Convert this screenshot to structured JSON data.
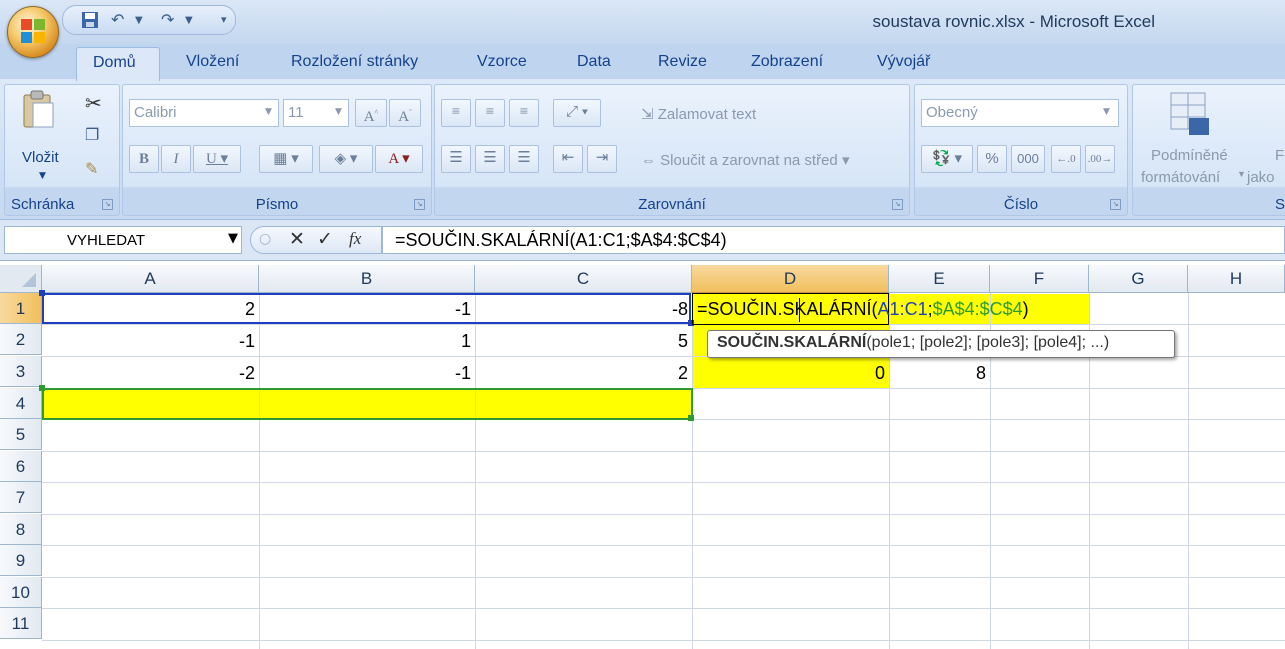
{
  "window": {
    "title": "soustava rovnic.xlsx - Microsoft Excel"
  },
  "tabs": [
    "Domů",
    "Vložení",
    "Rozložení stránky",
    "Vzorce",
    "Data",
    "Revize",
    "Zobrazení",
    "Vývojář"
  ],
  "ribbon": {
    "clipboard": {
      "label": "Schránka",
      "paste": "Vložit"
    },
    "font": {
      "label": "Písmo",
      "name": "Calibri",
      "size": "11"
    },
    "alignment": {
      "label": "Zarovnání",
      "wrap": "Zalamovat text",
      "merge": "Sloučit a zarovnat na střed"
    },
    "number": {
      "label": "Číslo",
      "format": "Obecný",
      "percent": "%",
      "thousands": "000"
    },
    "styles": {
      "cond_line1": "Podmíněné",
      "cond_line2": "formátování",
      "next_line1": "Fo",
      "next_line2": "jako",
      "label": "S"
    }
  },
  "formula_bar": {
    "name_box": "VYHLEDAT",
    "formula": "=SOUČIN.SKALÁRNÍ(A1:C1;$A$4:$C$4)"
  },
  "columns": [
    "A",
    "B",
    "C",
    "D",
    "E",
    "F",
    "G",
    "H"
  ],
  "rows": [
    "1",
    "2",
    "3",
    "4",
    "5",
    "6",
    "7",
    "8",
    "9",
    "10",
    "11"
  ],
  "cells": {
    "A1": "2",
    "B1": "-1",
    "C1": "-8",
    "A2": "-1",
    "B2": "1",
    "C2": "5",
    "A3": "-2",
    "B3": "-1",
    "C3": "2",
    "D3": "0",
    "E3": "8"
  },
  "edit_cell": {
    "prefix": "=SOUČIN.SKALÁRNÍ(",
    "ref1": "A1:C1",
    "sep": ";",
    "ref2": "$A$4:$C$4",
    "suffix": ")"
  },
  "tooltip": {
    "func": "SOUČIN.SKALÁRNÍ",
    "args": "(pole1; [pole2]; [pole3]; [pole4]; ...)"
  },
  "colors": {
    "highlight": "#ffff00",
    "ref1": "#1f3fbf",
    "ref2": "#2e9b2e",
    "selection_header": "#f1c05c"
  }
}
